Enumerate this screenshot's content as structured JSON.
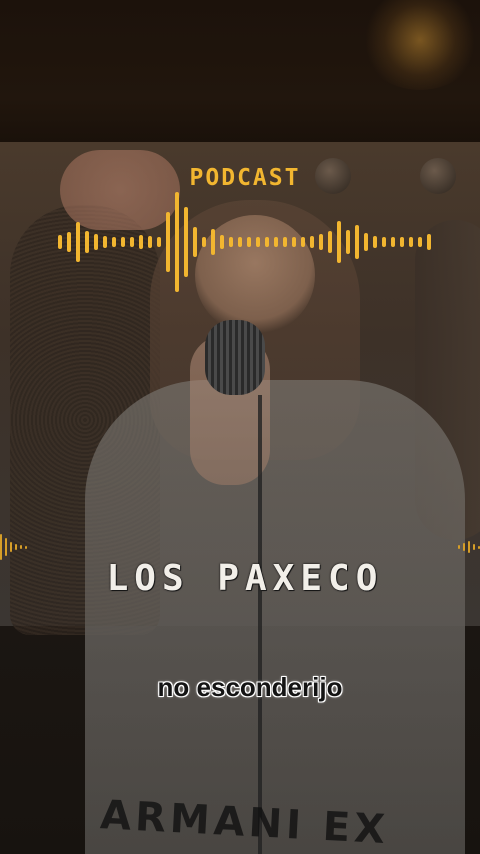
{
  "overlay": {
    "label": "PODCAST",
    "title": "LOS PAXECO",
    "caption": "no esconderijo"
  },
  "background_print": "ARMANI EX",
  "colors": {
    "accent": "#f2b630",
    "title_text": "#f2efe9",
    "caption_text": "#141414",
    "caption_outline": "#ffffff"
  },
  "icons": {
    "waveform": "audio-waveform-icon"
  }
}
